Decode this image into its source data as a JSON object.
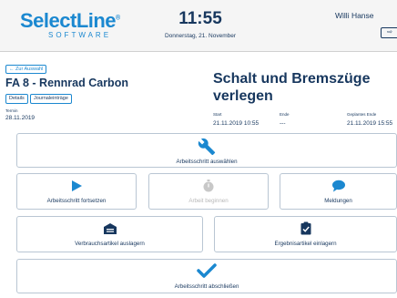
{
  "header": {
    "logo_main": "SelectLine",
    "logo_reg": "®",
    "logo_sub": "SOFTWARE",
    "time": "11:55",
    "date": "Donnerstag, 21. November",
    "user": "Willi Hanse"
  },
  "order": {
    "back_label": "Zur Auswahl",
    "title": "FA 8 - Rennrad Carbon",
    "details_label": "Details",
    "journal_label": "Journaleinträge",
    "termin_label": "Termin",
    "termin_value": "28.11.2019"
  },
  "operation": {
    "title": "Schalt und Bremszüge verlegen",
    "start_label": "Start",
    "start_value": "21.11.2019 10:55",
    "ende_label": "Ende",
    "ende_value": "---",
    "planned_end_label": "Geplantes Ende",
    "planned_end_value": "21.11.2019 15:55"
  },
  "actions": {
    "select_step": "Arbeitsschritt auswählen",
    "continue_step": "Arbeitsschritt fortsetzen",
    "start_work": "Arbeit beginnen",
    "messages": "Meldungen",
    "consume_articles": "Verbrauchsartikel auslagern",
    "store_results": "Ergebnisartikel einlagern",
    "finish_step": "Arbeitsschritt abschließen"
  },
  "colors": {
    "brand": "#1b88d0",
    "navy": "#17375e",
    "disabled": "#b8b8b8"
  }
}
